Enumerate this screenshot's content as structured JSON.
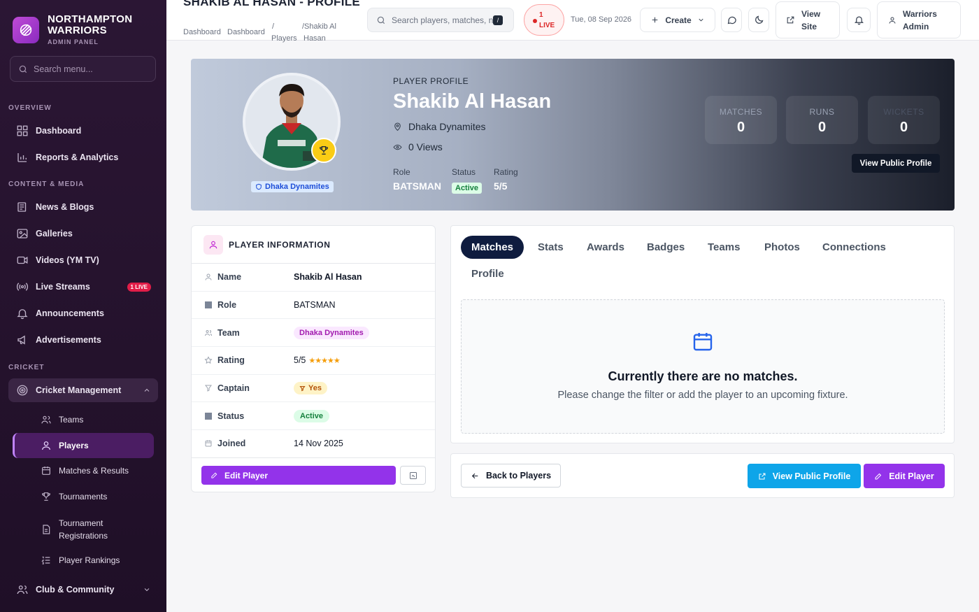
{
  "brand": {
    "name": "NORTHAMPTON WARRIORS",
    "sub": "ADMIN PANEL"
  },
  "sidebar": {
    "search_placeholder": "Search menu...",
    "sections": {
      "overview": "OVERVIEW",
      "content": "CONTENT & MEDIA",
      "cricket": "CRICKET"
    },
    "items": {
      "dashboard": "Dashboard",
      "reports": "Reports & Analytics",
      "news": "News & Blogs",
      "galleries": "Galleries",
      "videos": "Videos (YM TV)",
      "live": "Live Streams",
      "live_badge": "1 LIVE",
      "announcements": "Announcements",
      "ads": "Advertisements",
      "cricket_mgmt": "Cricket Management",
      "teams": "Teams",
      "players": "Players",
      "matches": "Matches & Results",
      "tournaments": "Tournaments",
      "tourn_reg": "Tournament Registrations",
      "rankings": "Player Rankings",
      "club": "Club & Community"
    }
  },
  "header": {
    "title": "SHAKIB AL HASAN - PROFILE",
    "crumbs": {
      "a": "Dashboard",
      "b": "Dashboard",
      "sep1": "/",
      "c": "Players",
      "sep2": "/Shakib Al",
      "d": "Hasan"
    },
    "search_placeholder": "Search players, matches, n",
    "kbd": "/",
    "live_count": "1",
    "live_label": "LIVE",
    "date": "Tue, 08 Sep 2026",
    "create": "Create",
    "view_site_1": "View",
    "view_site_2": "Site",
    "user_1": "Warriors",
    "user_2": "Admin"
  },
  "hero": {
    "label": "PLAYER PROFILE",
    "name": "Shakib Al Hasan",
    "team": "Dhaka Dynamites",
    "views": "0 Views",
    "team_chip": "Dhaka Dynamites",
    "role_label": "Role",
    "role": "BATSMAN",
    "status_label": "Status",
    "status": "Active",
    "rating_label": "Rating",
    "rating": "5/5",
    "stats": [
      {
        "label": "MATCHES",
        "value": "0"
      },
      {
        "label": "RUNS",
        "value": "0"
      },
      {
        "label": "WICKETS",
        "value": "0"
      }
    ],
    "view_public": "View Public Profile"
  },
  "info": {
    "title": "PLAYER INFORMATION",
    "rows": {
      "name_k": "Name",
      "name_v": "Shakib Al Hasan",
      "role_k": "Role",
      "role_v": "BATSMAN",
      "team_k": "Team",
      "team_v": "Dhaka Dynamites",
      "rating_k": "Rating",
      "rating_v": "5/5",
      "stars": "★★★★★",
      "captain_k": "Captain",
      "captain_v": "Yes",
      "status_k": "Status",
      "status_v": "Active",
      "joined_k": "Joined",
      "joined_v": "14 Nov 2025"
    },
    "edit": "Edit Player"
  },
  "tabs": [
    "Matches",
    "Stats",
    "Awards",
    "Badges",
    "Teams",
    "Photos",
    "Connections",
    "Profile"
  ],
  "empty": {
    "title": "Currently there are no matches.",
    "sub": "Please change the filter or add the player to an upcoming fixture."
  },
  "actions": {
    "back": "Back to Players",
    "public": "View Public Profile",
    "edit": "Edit Player"
  }
}
